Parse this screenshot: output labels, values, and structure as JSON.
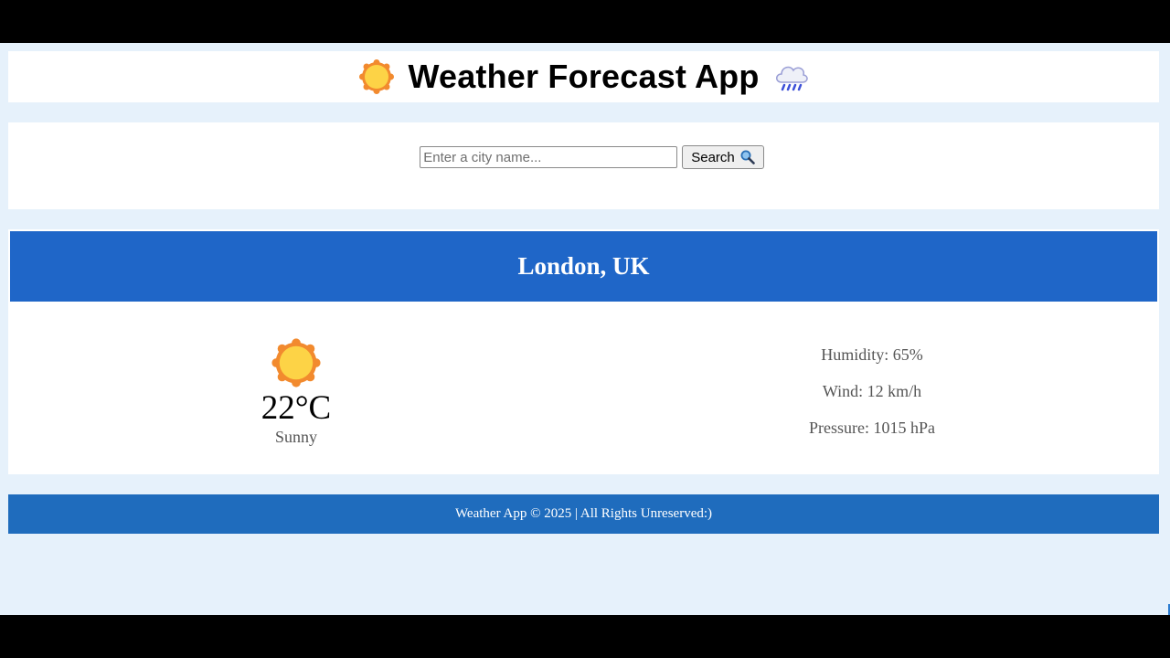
{
  "header": {
    "title": "Weather Forecast App",
    "left_icon": "sun-icon",
    "right_icon": "rain-cloud-icon"
  },
  "search": {
    "placeholder": "Enter a city name...",
    "value": "",
    "button_label": "Search",
    "button_icon": "magnifier-icon"
  },
  "weather": {
    "city": "London, UK",
    "icon": "sun-icon",
    "temperature": "22°C",
    "condition": "Sunny",
    "details": {
      "humidity": "Humidity: 65%",
      "wind": "Wind: 12 km/h",
      "pressure": "Pressure: 1015 hPa"
    }
  },
  "footer": {
    "text": "Weather App © 2025 | All Rights Unreserved:)"
  },
  "colors": {
    "page_background": "#e6f1fb",
    "panel_background": "#ffffff",
    "city_bar": "#1f66c8",
    "footer": "#1f6cbd"
  }
}
